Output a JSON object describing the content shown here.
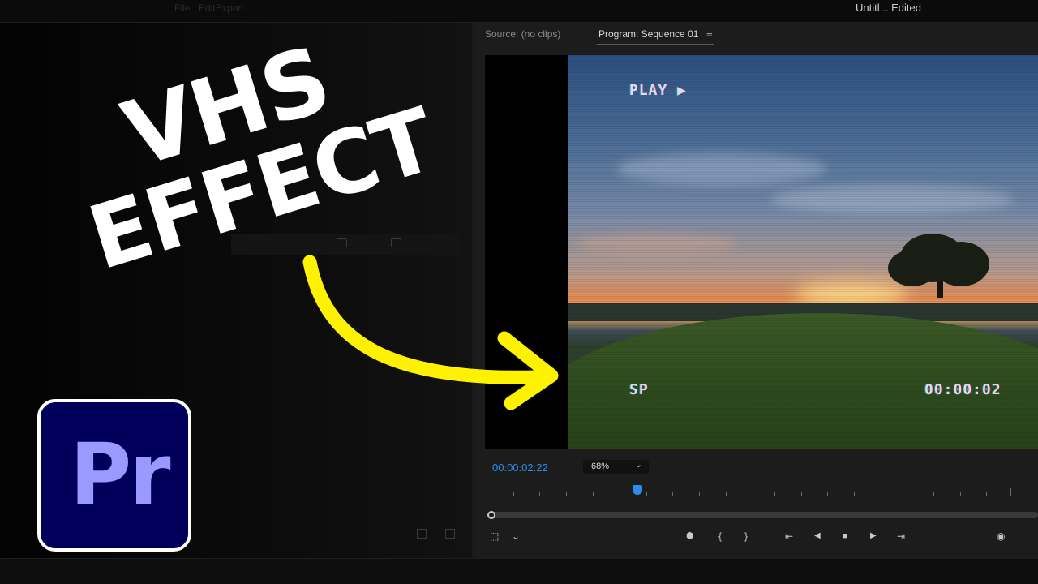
{
  "window": {
    "title": "Untitl... Edited",
    "menu_items": [
      "File",
      "Edit",
      "Export"
    ]
  },
  "monitor": {
    "source_tab": "Source: (no clips)",
    "program_tab": "Program: Sequence 01",
    "tab_menu_icon": "≡",
    "timecode": "00:00:02:22",
    "zoom": "68%",
    "zoom_caret": "⌄"
  },
  "video_overlay": {
    "play_label": "PLAY ▶",
    "mode_label": "SP",
    "counter": "00:00:02"
  },
  "thumbnail": {
    "headline_line1": "VHS",
    "headline_line2": "EFFECT",
    "logo_text": "Pr",
    "arrow_color": "#fff200"
  },
  "controls": {
    "marker": "⬢",
    "mark_in": "{",
    "mark_out": "}",
    "go_to_in": "⇤",
    "step_back": "◀",
    "stop": "■",
    "step_forward": "▶",
    "go_to_out": "⇥",
    "export_frame": "◉",
    "settings_left": "⬚",
    "settings_caret": "⌄"
  },
  "colors": {
    "accent": "#2d8ceb",
    "premiere_logo_bg": "#00005b",
    "premiere_logo_text": "#9999ff"
  }
}
